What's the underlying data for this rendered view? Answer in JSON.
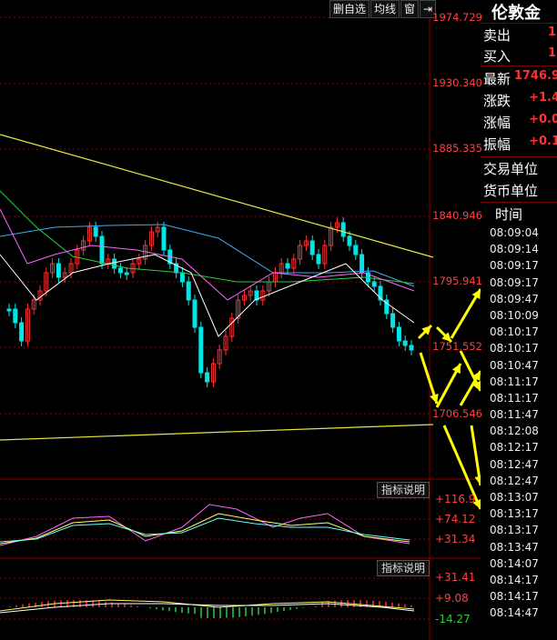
{
  "toolbar": {
    "delete_label": "删自选",
    "ma_label": "均线",
    "window_label": "窗",
    "arrow_icon": "exit-arrow-icon"
  },
  "price_axis": [
    "1974.729",
    "1930.340",
    "1885.335",
    "1840.946",
    "1795.941",
    "1751.552",
    "1706.546"
  ],
  "indicator1": {
    "button_label": "指标说明",
    "labels": [
      "+116.9",
      "+74.12",
      "+31.34"
    ]
  },
  "indicator2": {
    "button_label": "指标说明",
    "labels": [
      "+31.41",
      "+9.08",
      "-14.27"
    ]
  },
  "quote_panel": {
    "title": "伦敦金",
    "sell_label": "卖出",
    "sell_value": "1",
    "buy_label": "买入",
    "buy_value": "1",
    "last_label": "最新",
    "last_value": "1746.9",
    "change_label": "涨跌",
    "change_value": "+1.4",
    "pct_label": "涨幅",
    "pct_value": "+0.0",
    "amp_label": "振幅",
    "amp_value": "+0.1",
    "unit_label": "交易单位",
    "currency_label": "货币单位",
    "time_header": "时间",
    "times": [
      "08:09:04",
      "08:09:14",
      "08:09:17",
      "08:09:17",
      "08:09:47",
      "08:10:09",
      "08:10:17",
      "08:10:17",
      "08:10:47",
      "08:11:17",
      "08:11:17",
      "08:11:47",
      "08:12:08",
      "08:12:17",
      "08:12:47",
      "08:12:47",
      "08:13:07",
      "08:13:17",
      "08:13:17",
      "08:13:47",
      "08:14:07",
      "08:14:17",
      "08:14:17",
      "08:14:47"
    ]
  },
  "colors": {
    "up": "#ff3030",
    "down": "#00e5e5",
    "trendline": "#e8e840",
    "arrow": "#ffff00",
    "grid": "#8b0000"
  }
}
